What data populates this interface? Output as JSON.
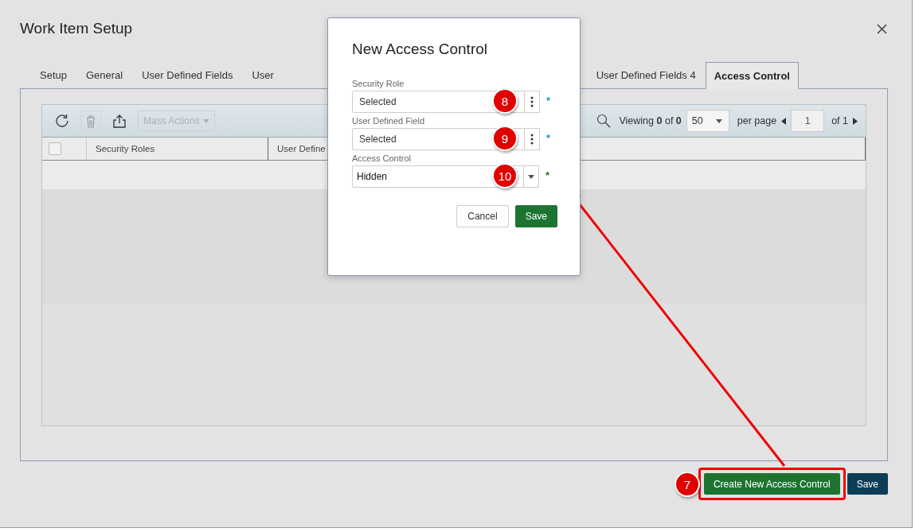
{
  "window": {
    "title": "Work Item Setup"
  },
  "tabs": [
    {
      "label": "Setup",
      "selected": false
    },
    {
      "label": "General",
      "selected": false
    },
    {
      "label": "User Defined Fields",
      "selected": false
    },
    {
      "label": "User",
      "selected": false
    },
    {
      "label": "User Defined Fields 4",
      "selected": false
    },
    {
      "label": "Access Control",
      "selected": true
    }
  ],
  "grid": {
    "toolbar": [
      {
        "kind": "refresh",
        "disabled": false
      },
      {
        "kind": "delete",
        "disabled": true
      },
      {
        "kind": "export",
        "disabled": false
      },
      {
        "kind": "menu",
        "label": "Mass Actions",
        "disabled": true
      }
    ],
    "pager": {
      "viewing": "Viewing **0** of **0**",
      "page_size": "50",
      "per_page": "per page",
      "page": "1",
      "page_count": "of 1"
    },
    "select_all": {
      "checked": false
    },
    "columns": [
      "Security Roles",
      "User Define"
    ]
  },
  "dialog": {
    "title": "New Access Control",
    "fields": [
      {
        "label": "Security Role",
        "value": "Selected",
        "kind": "picker",
        "marker": "8",
        "required": "*",
        "color": "#2196c9"
      },
      {
        "label": "User Defined Field",
        "value": "Selected",
        "kind": "picker",
        "marker": "9",
        "required": "*",
        "color": "#2196c9"
      },
      {
        "label": "Access Control",
        "value": "Hidden",
        "kind": "dropdown",
        "marker": "10",
        "required": "*",
        "color": "#1e7a30"
      }
    ],
    "buttons": [
      {
        "label": "Cancel",
        "kind": "secondary"
      },
      {
        "label": "Save",
        "kind": "primary"
      }
    ]
  },
  "footer": {
    "buttons": [
      {
        "label": "Create New Access Control",
        "kind": "primary",
        "marker": "7",
        "highlighted": true
      },
      {
        "label": "Save",
        "kind": "dark"
      }
    ]
  }
}
